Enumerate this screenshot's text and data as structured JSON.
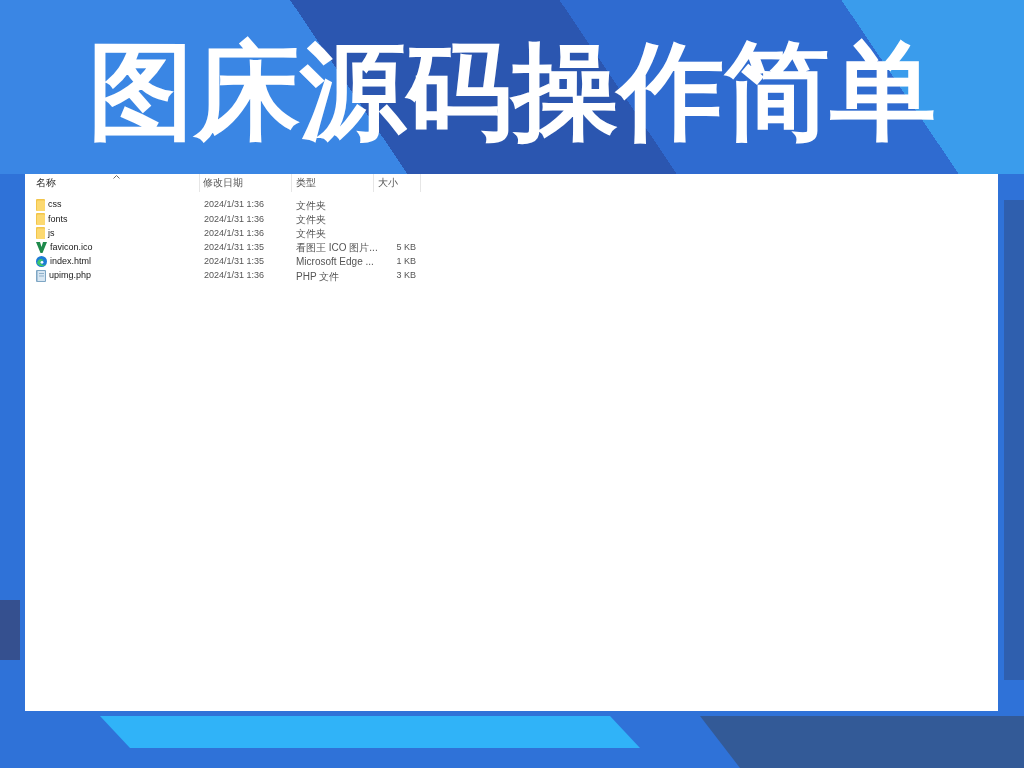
{
  "title": "图床源码操作简单",
  "file_list": {
    "columns": [
      {
        "label": "名称",
        "sorted": true
      },
      {
        "label": "修改日期",
        "sorted": false
      },
      {
        "label": "类型",
        "sorted": false
      },
      {
        "label": "大小",
        "sorted": false
      }
    ],
    "rows": [
      {
        "kind": "folder",
        "name": "css",
        "modified": "2024/1/31 1:36",
        "type": "文件夹"
      },
      {
        "kind": "folder",
        "name": "fonts",
        "modified": "2024/1/31 1:36",
        "type": "文件夹"
      },
      {
        "kind": "folder",
        "name": "js",
        "modified": "2024/1/31 1:36",
        "type": "文件夹"
      },
      {
        "kind": "icon_file",
        "name": "favicon.ico",
        "modified": "2024/1/31 1:35",
        "type": "看图王 ICO 图片...",
        "size": "5 KB"
      },
      {
        "kind": "html",
        "name": "index.html",
        "modified": "2024/1/31 1:35",
        "type": "Microsoft Edge ...",
        "size": "1 KB"
      },
      {
        "kind": "php",
        "name": "upimg.php",
        "modified": "2024/1/31 1:36",
        "type": "PHP 文件",
        "size": "3 KB"
      }
    ]
  }
}
